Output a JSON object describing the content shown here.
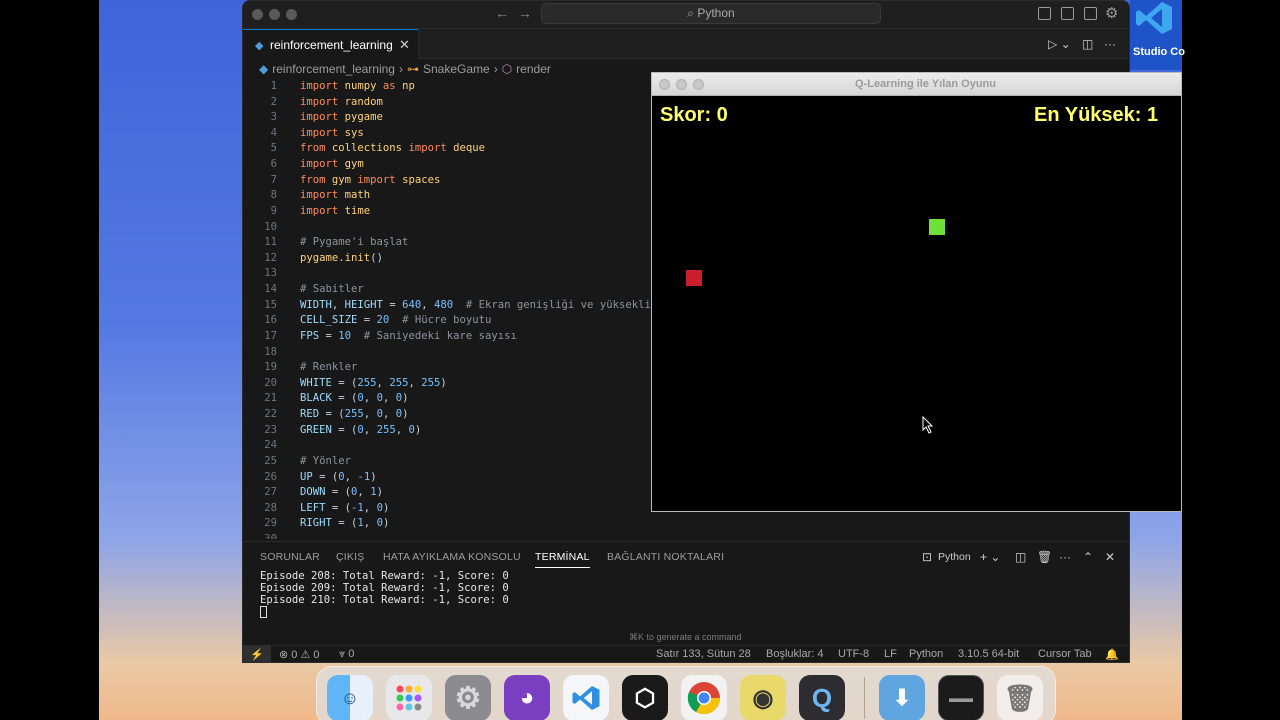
{
  "vscode_window": {
    "search_label": "Python",
    "tab_label": "reinforcement_learning",
    "breadcrumb": [
      "reinforcement_learning",
      "SnakeGame",
      "render"
    ],
    "code_lines": [
      {
        "n": "1",
        "parts": [
          [
            "kw",
            "import "
          ],
          [
            "mod",
            "numpy"
          ],
          [
            "kw",
            " as "
          ],
          [
            "mod",
            "np"
          ]
        ]
      },
      {
        "n": "2",
        "parts": [
          [
            "kw",
            "import "
          ],
          [
            "mod",
            "random"
          ]
        ]
      },
      {
        "n": "3",
        "parts": [
          [
            "kw",
            "import "
          ],
          [
            "mod",
            "pygame"
          ]
        ]
      },
      {
        "n": "4",
        "parts": [
          [
            "kw",
            "import "
          ],
          [
            "mod",
            "sys"
          ]
        ]
      },
      {
        "n": "5",
        "parts": [
          [
            "kw",
            "from "
          ],
          [
            "mod",
            "collections"
          ],
          [
            "kw",
            " import "
          ],
          [
            "mod",
            "deque"
          ]
        ]
      },
      {
        "n": "6",
        "parts": [
          [
            "kw",
            "import "
          ],
          [
            "mod",
            "gym"
          ]
        ]
      },
      {
        "n": "7",
        "parts": [
          [
            "kw",
            "from "
          ],
          [
            "mod",
            "gym"
          ],
          [
            "kw",
            " import "
          ],
          [
            "mod",
            "spaces"
          ]
        ]
      },
      {
        "n": "8",
        "parts": [
          [
            "kw",
            "import "
          ],
          [
            "mod",
            "math"
          ]
        ]
      },
      {
        "n": "9",
        "parts": [
          [
            "kw",
            "import "
          ],
          [
            "mod",
            "time"
          ]
        ]
      },
      {
        "n": "10",
        "parts": []
      },
      {
        "n": "11",
        "parts": [
          [
            "cm",
            "# Pygame'i başlat"
          ]
        ]
      },
      {
        "n": "12",
        "parts": [
          [
            "mod",
            "pygame"
          ],
          [
            "pl",
            "."
          ],
          [
            "mod",
            "init"
          ],
          [
            "pl",
            "()"
          ]
        ]
      },
      {
        "n": "13",
        "parts": []
      },
      {
        "n": "14",
        "parts": [
          [
            "cm",
            "# Sabitler"
          ]
        ]
      },
      {
        "n": "15",
        "parts": [
          [
            "var",
            "WIDTH"
          ],
          [
            "pl",
            ", "
          ],
          [
            "var",
            "HEIGHT"
          ],
          [
            "pl",
            " = "
          ],
          [
            "num",
            "640"
          ],
          [
            "pl",
            ", "
          ],
          [
            "num",
            "480"
          ],
          [
            "cm",
            "  # Ekran genişliği ve yüksekliğ"
          ]
        ]
      },
      {
        "n": "16",
        "parts": [
          [
            "var",
            "CELL_SIZE"
          ],
          [
            "pl",
            " = "
          ],
          [
            "num",
            "20"
          ],
          [
            "cm",
            "  # Hücre boyutu"
          ]
        ]
      },
      {
        "n": "17",
        "parts": [
          [
            "var",
            "FPS"
          ],
          [
            "pl",
            " = "
          ],
          [
            "num",
            "10"
          ],
          [
            "cm",
            "  # Saniyedeki kare sayısı"
          ]
        ]
      },
      {
        "n": "18",
        "parts": []
      },
      {
        "n": "19",
        "parts": [
          [
            "cm",
            "# Renkler"
          ]
        ]
      },
      {
        "n": "20",
        "parts": [
          [
            "var",
            "WHITE"
          ],
          [
            "pl",
            " = ("
          ],
          [
            "num",
            "255"
          ],
          [
            "pl",
            ", "
          ],
          [
            "num",
            "255"
          ],
          [
            "pl",
            ", "
          ],
          [
            "num",
            "255"
          ],
          [
            "pl",
            ")"
          ]
        ]
      },
      {
        "n": "21",
        "parts": [
          [
            "var",
            "BLACK"
          ],
          [
            "pl",
            " = ("
          ],
          [
            "num",
            "0"
          ],
          [
            "pl",
            ", "
          ],
          [
            "num",
            "0"
          ],
          [
            "pl",
            ", "
          ],
          [
            "num",
            "0"
          ],
          [
            "pl",
            ")"
          ]
        ]
      },
      {
        "n": "22",
        "parts": [
          [
            "var",
            "RED"
          ],
          [
            "pl",
            " = ("
          ],
          [
            "num",
            "255"
          ],
          [
            "pl",
            ", "
          ],
          [
            "num",
            "0"
          ],
          [
            "pl",
            ", "
          ],
          [
            "num",
            "0"
          ],
          [
            "pl",
            ")"
          ]
        ]
      },
      {
        "n": "23",
        "parts": [
          [
            "var",
            "GREEN"
          ],
          [
            "pl",
            " = ("
          ],
          [
            "num",
            "0"
          ],
          [
            "pl",
            ", "
          ],
          [
            "num",
            "255"
          ],
          [
            "pl",
            ", "
          ],
          [
            "num",
            "0"
          ],
          [
            "pl",
            ")"
          ]
        ]
      },
      {
        "n": "24",
        "parts": []
      },
      {
        "n": "25",
        "parts": [
          [
            "cm",
            "# Yönler"
          ]
        ]
      },
      {
        "n": "26",
        "parts": [
          [
            "var",
            "UP"
          ],
          [
            "pl",
            " = ("
          ],
          [
            "num",
            "0"
          ],
          [
            "pl",
            ", "
          ],
          [
            "num",
            "-1"
          ],
          [
            "pl",
            ")"
          ]
        ]
      },
      {
        "n": "27",
        "parts": [
          [
            "var",
            "DOWN"
          ],
          [
            "pl",
            " = ("
          ],
          [
            "num",
            "0"
          ],
          [
            "pl",
            ", "
          ],
          [
            "num",
            "1"
          ],
          [
            "pl",
            ")"
          ]
        ]
      },
      {
        "n": "28",
        "parts": [
          [
            "var",
            "LEFT"
          ],
          [
            "pl",
            " = ("
          ],
          [
            "num",
            "-1"
          ],
          [
            "pl",
            ", "
          ],
          [
            "num",
            "0"
          ],
          [
            "pl",
            ")"
          ]
        ]
      },
      {
        "n": "29",
        "parts": [
          [
            "var",
            "RIGHT"
          ],
          [
            "pl",
            " = ("
          ],
          [
            "num",
            "1"
          ],
          [
            "pl",
            ", "
          ],
          [
            "num",
            "0"
          ],
          [
            "pl",
            ")"
          ]
        ]
      },
      {
        "n": "30",
        "parts": []
      }
    ],
    "panel_tabs": [
      "SORUNLAR",
      "ÇIKIŞ",
      "HATA AYIKLAMA KONSOLU",
      "TERMİNAL",
      "BAĞLANTI NOKTALARI"
    ],
    "active_panel_tab": "TERMİNAL",
    "terminal_profile": "Python",
    "terminal_lines": [
      "Episode 208: Total Reward: -1, Score: 0",
      "Episode 209: Total Reward: -1, Score: 0",
      "Episode 210: Total Reward: -1, Score: 0"
    ],
    "terminal_hint": "⌘K to generate a command",
    "status": {
      "errors": "0",
      "warnings": "0",
      "ports": "0",
      "position": "Satır 133, Sütun 28",
      "spaces": "Boşluklar: 4",
      "encoding": "UTF-8",
      "eol": "LF",
      "language": "Python",
      "interpreter": "3.10.5 64-bit",
      "cursor_tab": "Cursor Tab"
    }
  },
  "game_window": {
    "title": "Q-Learning ile Yılan Oyunu",
    "score_text": "Skor: 0",
    "high_score_text": "En Yüksek: 1",
    "food_color": "#cc1d2c",
    "snake_color": "#6de03a"
  },
  "desktop": {
    "vscode_label": "Studio Co"
  },
  "dock_apps": [
    "finder-icon",
    "launchpad-icon",
    "system-settings-icon",
    "github-desktop-icon",
    "vscode-icon",
    "unity-icon",
    "chrome-icon",
    "cyberduck-icon",
    "quicktime-icon",
    "downloads-folder-icon",
    "terminal-window-icon",
    "trash-icon"
  ]
}
